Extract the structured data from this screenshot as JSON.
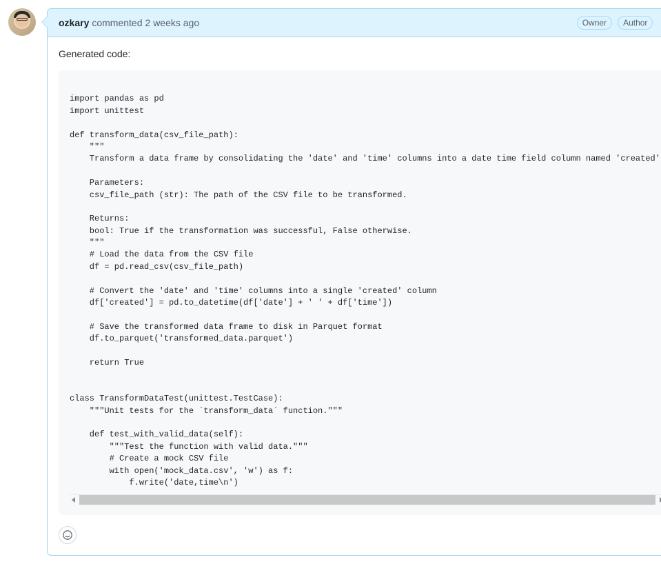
{
  "comment": {
    "username": "ozkary",
    "commented_text": "commented",
    "timestamp": "2 weeks ago",
    "badges": {
      "owner": "Owner",
      "author": "Author"
    },
    "body_text": "Generated code:",
    "code": "\nimport pandas as pd\nimport unittest\n\ndef transform_data(csv_file_path):\n    \"\"\"\n    Transform a data frame by consolidating the 'date' and 'time' columns into a date time field column named 'created'.\n\n    Parameters:\n    csv_file_path (str): The path of the CSV file to be transformed.\n\n    Returns:\n    bool: True if the transformation was successful, False otherwise.\n    \"\"\"\n    # Load the data from the CSV file\n    df = pd.read_csv(csv_file_path)\n\n    # Convert the 'date' and 'time' columns into a single 'created' column\n    df['created'] = pd.to_datetime(df['date'] + ' ' + df['time'])\n\n    # Save the transformed data frame to disk in Parquet format\n    df.to_parquet('transformed_data.parquet')\n\n    return True\n\n\nclass TransformDataTest(unittest.TestCase):\n    \"\"\"Unit tests for the `transform_data` function.\"\"\"\n\n    def test_with_valid_data(self):\n        \"\"\"Test the function with valid data.\"\"\"\n        # Create a mock CSV file\n        with open('mock_data.csv', 'w') as f:\n            f.write('date,time\\n')"
  }
}
